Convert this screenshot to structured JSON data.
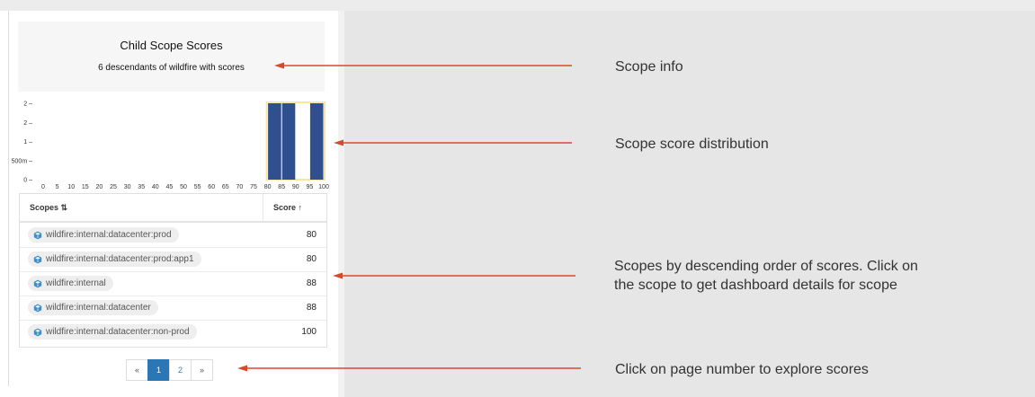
{
  "info": {
    "title": "Child Scope Scores",
    "subtitle": "6 descendants of wildfire with scores"
  },
  "chart_data": {
    "type": "bar",
    "x_ticks": [
      "0",
      "5",
      "10",
      "15",
      "20",
      "25",
      "30",
      "35",
      "40",
      "45",
      "50",
      "55",
      "60",
      "65",
      "70",
      "75",
      "80",
      "85",
      "90",
      "95",
      "100"
    ],
    "y_ticks": [
      "0",
      "500m",
      "1",
      "2",
      "2"
    ],
    "xlim": [
      0,
      100
    ],
    "ylim": [
      0,
      2
    ],
    "bins": [
      {
        "x_start": 80,
        "x_end": 85,
        "count": 2
      },
      {
        "x_start": 85,
        "x_end": 90,
        "count": 2
      },
      {
        "x_start": 90,
        "x_end": 95,
        "count": 0
      },
      {
        "x_start": 95,
        "x_end": 100,
        "count": 2
      }
    ],
    "bar_color": "#2f4f8f",
    "highlight_color": "#f5e6a3"
  },
  "table": {
    "col_scopes": "Scopes ⇅",
    "col_score": "Score ↑",
    "rows": [
      {
        "scope": "wildfire:internal:datacenter:prod",
        "score": "80"
      },
      {
        "scope": "wildfire:internal:datacenter:prod:app1",
        "score": "80"
      },
      {
        "scope": "wildfire:internal",
        "score": "88"
      },
      {
        "scope": "wildfire:internal:datacenter",
        "score": "88"
      },
      {
        "scope": "wildfire:internal:datacenter:non-prod",
        "score": "100"
      }
    ]
  },
  "pager": {
    "prev": "«",
    "pages": [
      "1",
      "2"
    ],
    "next": "»",
    "active_page": "1"
  },
  "annotations": {
    "scope_info": "Scope info",
    "distribution": "Scope score distribution",
    "table_line1": "Scopes by descending order of scores. Click on",
    "table_line2": "the scope to get dashboard details for scope",
    "pager": "Click on page number to explore scores"
  },
  "colors": {
    "arrow": "#d64a2c",
    "page_active": "#2b77b5",
    "scope_icon": "#3d8fc6"
  }
}
